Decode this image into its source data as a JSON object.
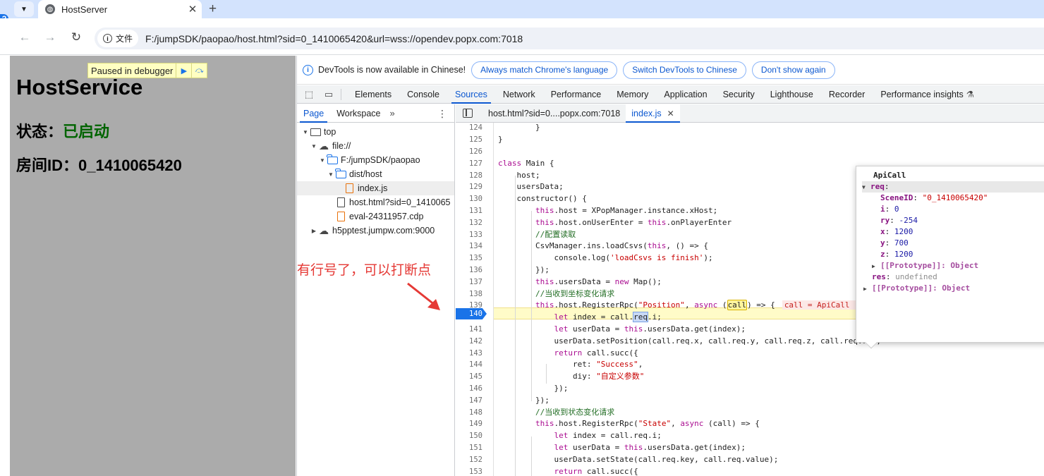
{
  "browser": {
    "tab_title": "HostServer",
    "tab_close": "✕",
    "new_tab": "+",
    "address_chip": "文件",
    "url": "F:/jumpSDK/paopao/host.html?sid=0_1410065420&url=wss://opendev.popx.com:7018"
  },
  "page": {
    "paused_label": "Paused in debugger",
    "title": "HostService",
    "status_label": "状态：",
    "status_value": "已启动",
    "room_label": "房间ID：",
    "room_value": "0_1410065420"
  },
  "devtools": {
    "infobar": {
      "message": "DevTools is now available in Chinese!",
      "btn_match": "Always match Chrome's language",
      "btn_switch": "Switch DevTools to Chinese",
      "btn_dismiss": "Don't show again"
    },
    "tabs": [
      "Elements",
      "Console",
      "Sources",
      "Network",
      "Performance",
      "Memory",
      "Application",
      "Security",
      "Lighthouse",
      "Recorder",
      "Performance insights"
    ],
    "active_tab": "Sources",
    "navigator": {
      "tab_page": "Page",
      "tab_workspace": "Workspace",
      "more": "»",
      "tree": [
        "top",
        "file://",
        "F:/jumpSDK/paopao",
        "dist/host",
        "index.js",
        "host.html?sid=0_1410065",
        "eval-24311957.cdp",
        "h5pptest.jumpw.com:9000"
      ]
    },
    "editor_tabs": {
      "tab1": "host.html?sid=0....popx.com:7018",
      "tab2": "index.js"
    },
    "breakpoint_line": "140",
    "popover": {
      "title": "ApiCall",
      "req_key": "req",
      "scene_key": "SceneID",
      "scene_val": "\"0_1410065420\"",
      "i_key": "i",
      "i_val": "0",
      "ry_key": "ry",
      "ry_val": "-254",
      "x_key": "x",
      "x_val": "1200",
      "y_key": "y",
      "y_val": "700",
      "z_key": "z",
      "z_val": "1200",
      "proto1": "[[Prototype]]: Object",
      "res_key": "res",
      "res_val": "undefined",
      "proto2": "[[Prototype]]: Object"
    },
    "inline_value": "call = ApiCall  {req: {…}, res: undefined}"
  },
  "annotation": "有行号了，可以打断点",
  "colors": {
    "accent": "#0b57d0",
    "status_green": "#006400",
    "annotation_red": "#e53935",
    "breakpoint_blue": "#1a73e8"
  }
}
